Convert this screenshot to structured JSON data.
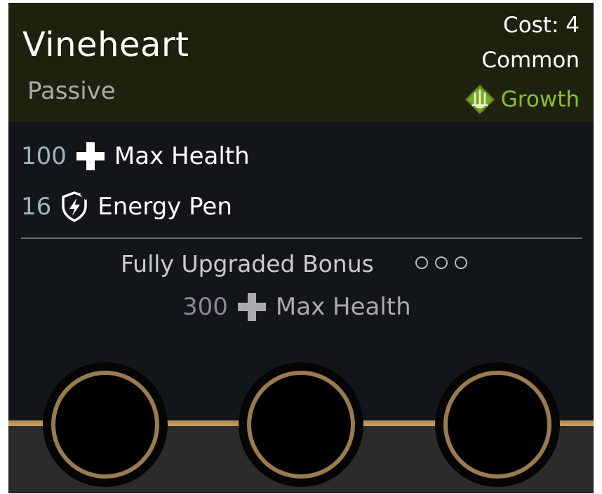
{
  "card": {
    "title": "Vineheart",
    "type": "Passive",
    "cost": "Cost: 4",
    "rarity": "Common",
    "category": {
      "label": "Growth",
      "icon": "growth-category-icon",
      "color": "#8ebf2a"
    }
  },
  "stats": [
    {
      "value": "100",
      "icon": "plus-health-icon",
      "label": "Max Health"
    },
    {
      "value": "16",
      "icon": "energy-pen-icon",
      "label": "Energy Pen"
    }
  ],
  "bonus": {
    "title": "Fully Upgraded Bonus",
    "upgrade_progress": {
      "filled": 0,
      "total": 3
    },
    "value": "300",
    "icon": "plus-health-icon",
    "label": "Max Health"
  },
  "sockets": [
    {
      "name": "socket-1",
      "state": "empty"
    },
    {
      "name": "socket-2",
      "state": "empty"
    },
    {
      "name": "socket-3",
      "state": "empty"
    }
  ],
  "colors": {
    "header_bg": "#1f210f",
    "body_bg": "#12161a",
    "accent_growth": "#8ebf2a",
    "socket_ring": "#9a7a50"
  }
}
